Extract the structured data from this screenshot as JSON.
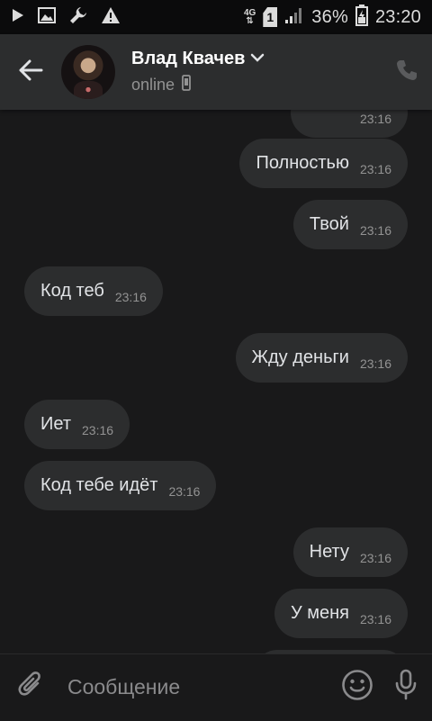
{
  "status_bar": {
    "icons": [
      "play-icon",
      "image-icon",
      "wrench-icon",
      "warning-icon"
    ],
    "network": "4G",
    "sim": "1",
    "battery": "36%",
    "time": "23:20"
  },
  "header": {
    "peer_name": "Влад Квачев",
    "peer_status": "online",
    "icons": [
      "back-arrow-icon",
      "chevron-down-icon",
      "mobile-phone-icon",
      "phone-call-icon"
    ]
  },
  "messages": [
    {
      "text": "",
      "time": "23:16",
      "side": "out"
    },
    {
      "text": "Полностью",
      "time": "23:16",
      "side": "out"
    },
    {
      "text": "Твой",
      "time": "23:16",
      "side": "out"
    },
    {
      "text": "Код теб",
      "time": "23:16",
      "side": "in"
    },
    {
      "text": "Жду деньги",
      "time": "23:16",
      "side": "out"
    },
    {
      "text": "Иет",
      "time": "23:16",
      "side": "in"
    },
    {
      "text": "Код тебе идёт",
      "time": "23:16",
      "side": "in"
    },
    {
      "text": "Нету",
      "time": "23:16",
      "side": "out"
    },
    {
      "text": "У меня",
      "time": "23:16",
      "side": "out"
    },
    {
      "text": "",
      "time": "",
      "side": "out"
    }
  ],
  "composer": {
    "placeholder": "Сообщение",
    "value": "",
    "icons": [
      "paperclip-icon",
      "smile-icon",
      "microphone-icon"
    ]
  },
  "colors": {
    "background": "#19191a",
    "bubble": "#2c2d2e",
    "header": "#2c2d2e",
    "status_bar": "#0b0b0c",
    "text_primary": "#e1e3e6",
    "text_secondary": "#939393"
  }
}
